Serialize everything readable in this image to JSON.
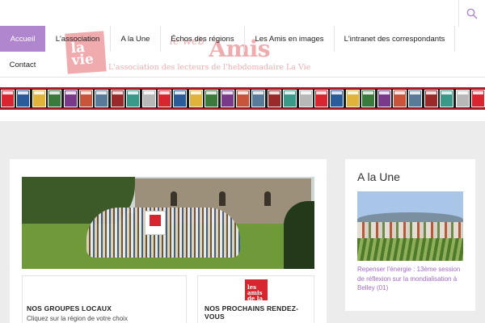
{
  "site": {
    "logo_text": "la vie",
    "logo_web_small": "le web",
    "logo_web_big": "Amis",
    "logo_tagline": "L'association des lecteurs de l'hebdomadaire La Vie"
  },
  "search": {
    "icon": "search-icon"
  },
  "nav": {
    "items": [
      {
        "label": "Accueil",
        "active": true
      },
      {
        "label": "L'association"
      },
      {
        "label": "A la Une"
      },
      {
        "label": "Échos des régions"
      },
      {
        "label": "Les Amis en images"
      },
      {
        "label": "L'intranet des correspondants"
      },
      {
        "label": "Contact"
      }
    ]
  },
  "colors": {
    "accent": "#b086cf",
    "brand_red": "#d9252f",
    "link": "#a06bc9"
  },
  "main": {
    "boxes": [
      {
        "title": "NOS GROUPES LOCAUX",
        "subtitle": "Cliquez sur la région de votre choix"
      },
      {
        "title": "NOS PROCHAINS RENDEZ-VOUS",
        "logo": "les amis de la vie"
      }
    ]
  },
  "sidebar": {
    "title": "A la Une",
    "article_link": "Repenser l'énergie : 13ème session de réflexion sur la mondialisation à Belley (01)"
  }
}
